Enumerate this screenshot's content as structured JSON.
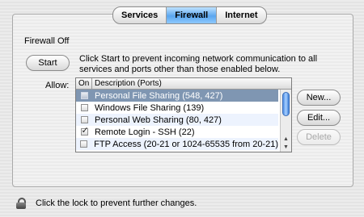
{
  "tabs": [
    {
      "label": "Services",
      "active": false
    },
    {
      "label": "Firewall",
      "active": true
    },
    {
      "label": "Internet",
      "active": false
    }
  ],
  "firewall": {
    "status": "Firewall Off",
    "start_label": "Start",
    "description": "Click Start to prevent incoming network communication to all services and ports other than those enabled below.",
    "allow_label": "Allow:"
  },
  "table": {
    "columns": [
      "On",
      "Description (Ports)"
    ],
    "rows": [
      {
        "on": false,
        "description": "Personal File Sharing (548, 427)",
        "selected": true
      },
      {
        "on": false,
        "description": "Windows File Sharing (139)",
        "selected": false
      },
      {
        "on": false,
        "description": "Personal Web Sharing (80, 427)",
        "selected": false
      },
      {
        "on": true,
        "description": "Remote Login - SSH (22)",
        "selected": false
      },
      {
        "on": false,
        "description": "FTP Access (20-21 or 1024-65535 from 20-21)",
        "selected": false
      }
    ]
  },
  "buttons": {
    "new_label": "New...",
    "edit_label": "Edit...",
    "delete_label": "Delete"
  },
  "lock": {
    "text": "Click the lock to prevent further changes.",
    "icon": "lock-icon"
  },
  "colors": {
    "selected_row": "#7f96b2",
    "active_tab": "#5aa6ef"
  }
}
